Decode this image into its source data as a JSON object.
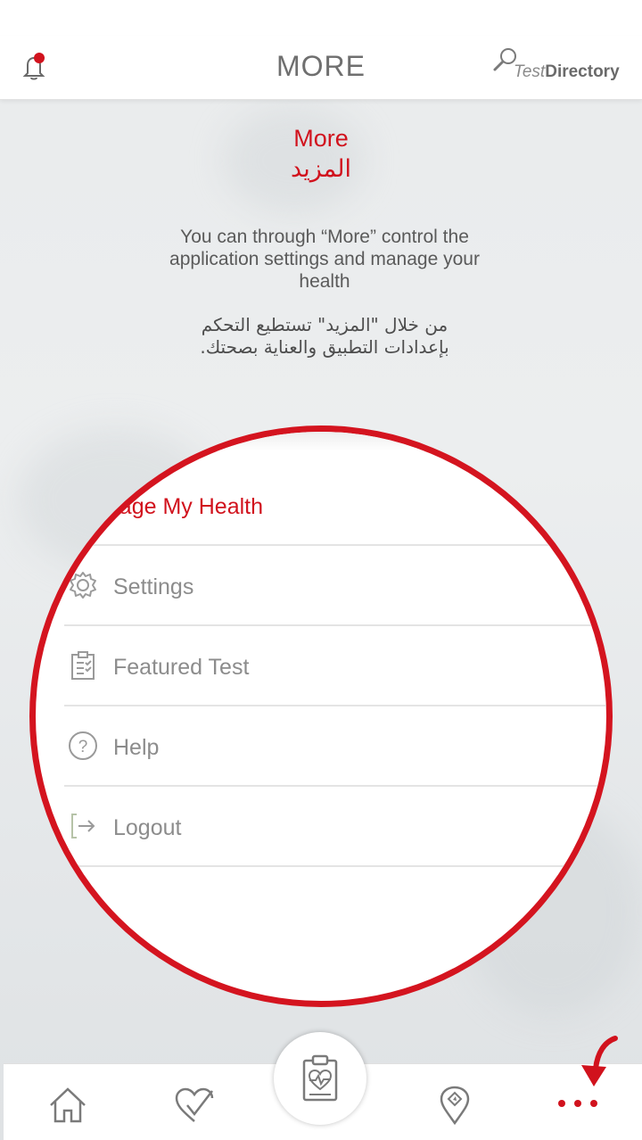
{
  "header": {
    "title": "MORE",
    "test_directory_prefix": "Test",
    "test_directory_suffix": "Directory",
    "bell_icon": "notification-bell-icon",
    "search_icon": "search-icon"
  },
  "intro": {
    "title_en": "More",
    "title_ar": "المزيد",
    "text_en": "You can through “More” control the application settings and manage your health",
    "text_ar": "من خلال \"المزيد\" تستطيع التحكم بإعدادات التطبيق والعناية بصحتك."
  },
  "menu": {
    "items": [
      {
        "label": "anage My Health",
        "icon": "heart-icon",
        "active": true
      },
      {
        "label": "Settings",
        "icon": "gear-icon",
        "active": false
      },
      {
        "label": "Featured Test",
        "icon": "clipboard-list-icon",
        "active": false
      },
      {
        "label": "Help",
        "icon": "question-circle-icon",
        "active": false
      },
      {
        "label": "Logout",
        "icon": "logout-icon",
        "active": false
      }
    ]
  },
  "tabbar": {
    "tabs": [
      "home-icon",
      "heart-check-icon",
      "clipboard-heart-icon",
      "location-pin-icon",
      "more-dots-icon"
    ],
    "active_tab": "more"
  },
  "colors": {
    "accent": "#d1121d",
    "muted_text": "#8c8c8c",
    "circle_border": "#d4141f"
  }
}
